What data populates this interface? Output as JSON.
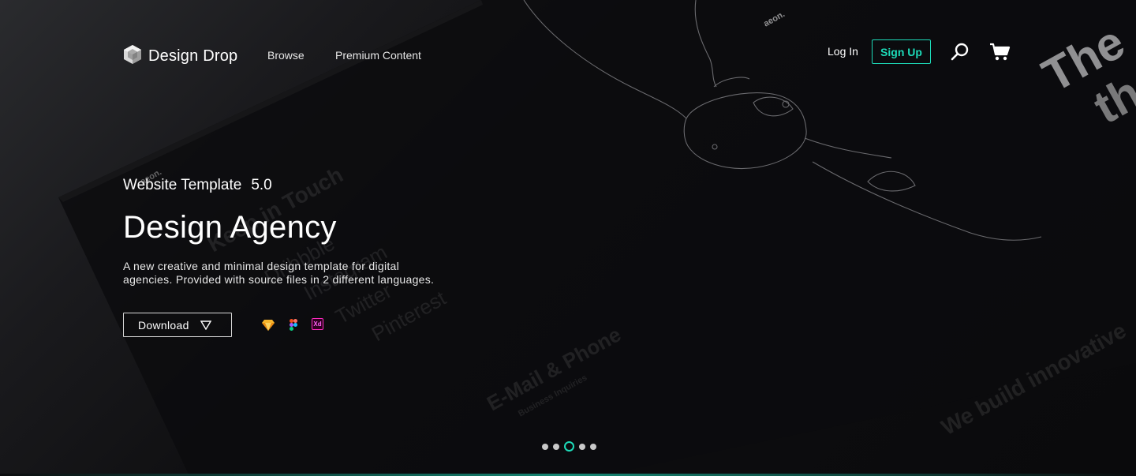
{
  "header": {
    "brand": "Design Drop",
    "nav": {
      "browse": "Browse",
      "premium": "Premium Content"
    },
    "login": "Log In",
    "signup": "Sign Up",
    "icons": {
      "logo": "hexagon-cube-icon",
      "search": "search-icon",
      "cart": "cart-icon"
    }
  },
  "hero": {
    "kicker": "Website Template",
    "version": "5.0",
    "title": "Design Agency",
    "description": "A new creative and minimal design template for digital agencies. Provided with source files in 2 different languages.",
    "download_label": "Download",
    "tools": [
      {
        "name": "sketch-icon",
        "label": ""
      },
      {
        "name": "figma-icon",
        "label": ""
      },
      {
        "name": "xd-icon",
        "label": "Xd"
      }
    ]
  },
  "background": {
    "words": [
      "Keep in Touch",
      "Dribbble",
      "Instagram",
      "Twitter",
      "Pinterest",
      "E-Mail & Phone",
      "Business Inquiries",
      "We build innovative",
      "The",
      "th",
      "aeon.",
      "aeon."
    ]
  },
  "slider": {
    "count": 5,
    "active_index": 2
  },
  "colors": {
    "accent": "#1ddbb9",
    "background": "#0b0b0d",
    "text": "#ffffff"
  }
}
